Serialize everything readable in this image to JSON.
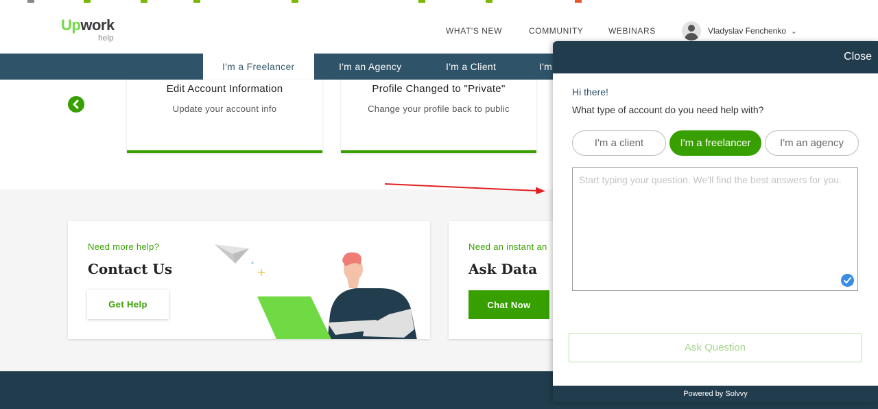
{
  "header": {
    "logo_main": "work",
    "logo_up": "Up",
    "logo_sub": "help",
    "nav": [
      "WHAT'S NEW",
      "COMMUNITY",
      "WEBINARS"
    ],
    "user_name": "Vladyslav Fenchenko",
    "user_caret": "⌄"
  },
  "tabs": [
    "I'm a Freelancer",
    "I'm an Agency",
    "I'm a Client",
    "I'm"
  ],
  "cards": [
    {
      "title": "Edit Account Information",
      "subtitle": "Update your account info"
    },
    {
      "title": "Profile Changed to \"Private\"",
      "subtitle": "Change your profile back to public"
    }
  ],
  "help": {
    "contact": {
      "kicker": "Need more help?",
      "title": "Contact Us",
      "button": "Get Help"
    },
    "data": {
      "kicker": "Need an instant an",
      "title": "Ask Data",
      "button": "Chat Now"
    }
  },
  "chat": {
    "close": "Close",
    "greeting": "Hi there!",
    "question": "What type of account do you need help with?",
    "options": [
      "I'm a client",
      "I'm a freelancer",
      "I'm an agency"
    ],
    "selected": "I'm a freelancer",
    "input_placeholder": "Start typing your question. We'll find the best answers for you.",
    "ask_button": "Ask Question",
    "powered_by": "Powered by Solvvy"
  },
  "colors": {
    "brand_green": "#37a000",
    "nav_blue": "#2f5368",
    "footer_navy": "#213c4d",
    "annotation_red": "#e02020"
  }
}
